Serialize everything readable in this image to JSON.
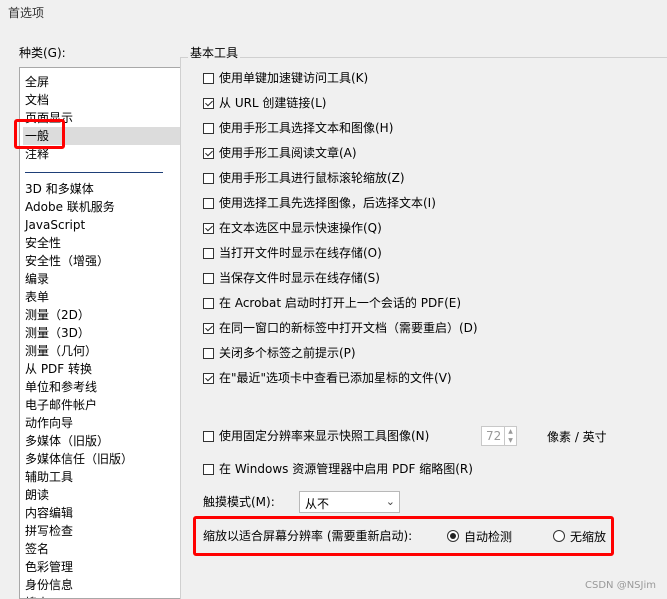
{
  "window": {
    "title": "首选项"
  },
  "categories": {
    "label": "种类(G):",
    "top_items": [
      "全屏",
      "文档",
      "页面显示",
      "一般",
      "注释"
    ],
    "items": [
      "3D 和多媒体",
      "Adobe 联机服务",
      "JavaScript",
      "安全性",
      "安全性（增强）",
      "编录",
      "表单",
      "测量（2D）",
      "测量（3D）",
      "测量（几何）",
      "从 PDF 转换",
      "单位和参考线",
      "电子邮件帐户",
      "动作向导",
      "多媒体（旧版）",
      "多媒体信任（旧版）",
      "辅助工具",
      "朗读",
      "内容编辑",
      "拼写检查",
      "签名",
      "色彩管理",
      "身份信息",
      "搜索"
    ],
    "selected": "一般"
  },
  "basic_tools": {
    "title": "基本工具",
    "options": [
      {
        "label": "使用单键加速键访问工具(K)",
        "checked": false
      },
      {
        "label": "从 URL 创建链接(L)",
        "checked": true
      },
      {
        "label": "使用手形工具选择文本和图像(H)",
        "checked": false
      },
      {
        "label": "使用手形工具阅读文章(A)",
        "checked": true
      },
      {
        "label": "使用手形工具进行鼠标滚轮缩放(Z)",
        "checked": false
      },
      {
        "label": "使用选择工具先选择图像，后选择文本(I)",
        "checked": false
      },
      {
        "label": "在文本选区中显示快速操作(Q)",
        "checked": true
      },
      {
        "label": "当打开文件时显示在线存储(O)",
        "checked": false
      },
      {
        "label": "当保存文件时显示在线存储(S)",
        "checked": false
      },
      {
        "label": "在 Acrobat 启动时打开上一个会话的 PDF(E)",
        "checked": false
      },
      {
        "label": "在同一窗口的新标签中打开文档（需要重启）(D)",
        "checked": true
      },
      {
        "label": "关闭多个标签之前提示(P)",
        "checked": false
      },
      {
        "label": "在\"最近\"选项卡中查看已添加星标的文件(V)",
        "checked": true
      }
    ]
  },
  "snapshot": {
    "label": "使用固定分辨率来显示快照工具图像(N)",
    "checked": false,
    "value": "72",
    "unit": "像素 / 英寸"
  },
  "thumbnail": {
    "label": "在 Windows 资源管理器中启用 PDF 缩略图(R)",
    "checked": false
  },
  "touch": {
    "label": "触摸模式(M):",
    "value": "从不"
  },
  "scaling": {
    "label": "缩放以适合屏幕分辨率 (需要重新启动):",
    "auto": "自动检测",
    "none": "无缩放",
    "selected": "auto"
  },
  "watermark": "CSDN @NSJim",
  "colors": {
    "highlight": "#ff0000",
    "separator": "#1e3f78"
  }
}
